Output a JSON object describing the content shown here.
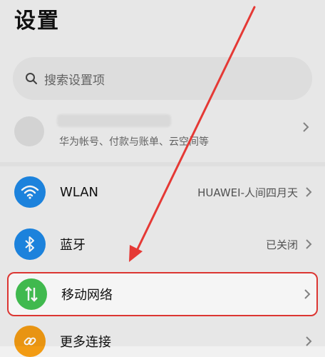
{
  "header": {
    "title": "设置"
  },
  "search": {
    "placeholder": "搜索设置项",
    "icon": "search-icon"
  },
  "account": {
    "description": "华为帐号、付款与账单、云空间等",
    "chevron_icon": "chevron-right-icon"
  },
  "items": [
    {
      "label": "WLAN",
      "value": "HUAWEI-人间四月天",
      "icon": "wifi-icon",
      "icon_color": "#1e88e5"
    },
    {
      "label": "蓝牙",
      "value": "已关闭",
      "icon": "bluetooth-icon",
      "icon_color": "#1e88e5"
    },
    {
      "label": "移动网络",
      "value": "",
      "icon": "mobile-data-icon",
      "icon_color": "#43c152"
    },
    {
      "label": "更多连接",
      "value": "",
      "icon": "link-icon",
      "icon_color": "#f29b13"
    }
  ],
  "colors": {
    "background": "#f1f1f1",
    "highlight_border": "#e53935",
    "arrow": "#e53935"
  }
}
